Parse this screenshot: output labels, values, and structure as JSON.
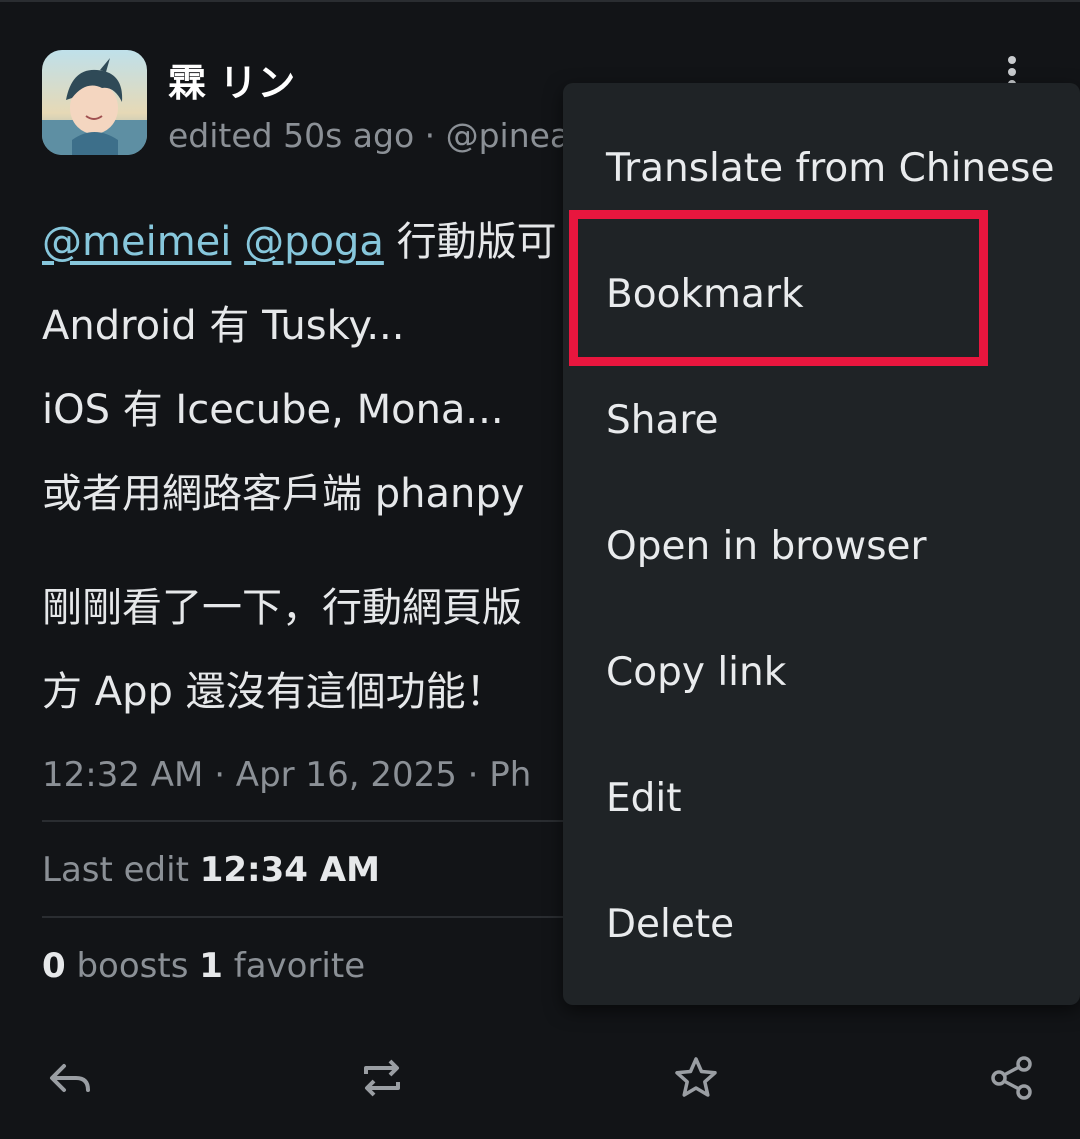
{
  "post": {
    "display_name": "霖 リン",
    "meta": "edited 50s ago · @pinea",
    "content": {
      "line1": {
        "mention1": "@meimei",
        "mention2": "@poga",
        "text": " 行動版可"
      },
      "line2": "Android 有 Tusky...",
      "line3": "iOS 有 Icecube, Mona...",
      "line4": "或者用網路客戶端 phanpy",
      "line5": "剛剛看了一下，行動網頁版",
      "line6": "方 App 還沒有這個功能！"
    },
    "timestamp": "12:32 AM  ·  Apr 16, 2025  ·  Ph",
    "last_edit_label": "Last edit ",
    "last_edit_time": "12:34 AM",
    "boosts_count": "0",
    "boosts_label": " boosts",
    "favorites_count": "1",
    "favorites_label": " favorite"
  },
  "menu": {
    "items": [
      {
        "label": "Translate from Chinese"
      },
      {
        "label": "Bookmark"
      },
      {
        "label": "Share"
      },
      {
        "label": "Open in browser"
      },
      {
        "label": "Copy link"
      },
      {
        "label": "Edit"
      },
      {
        "label": "Delete"
      }
    ],
    "highlighted_item": "Bookmark",
    "highlight_color": "#e8163e"
  },
  "actions": {
    "icons": [
      "reply-icon",
      "boost-icon",
      "favorite-star-icon",
      "share-icon"
    ]
  },
  "colors": {
    "background": "#121417",
    "menu_background": "#1f2326",
    "mention": "#87c7dc",
    "secondary_text": "#8b9096"
  }
}
